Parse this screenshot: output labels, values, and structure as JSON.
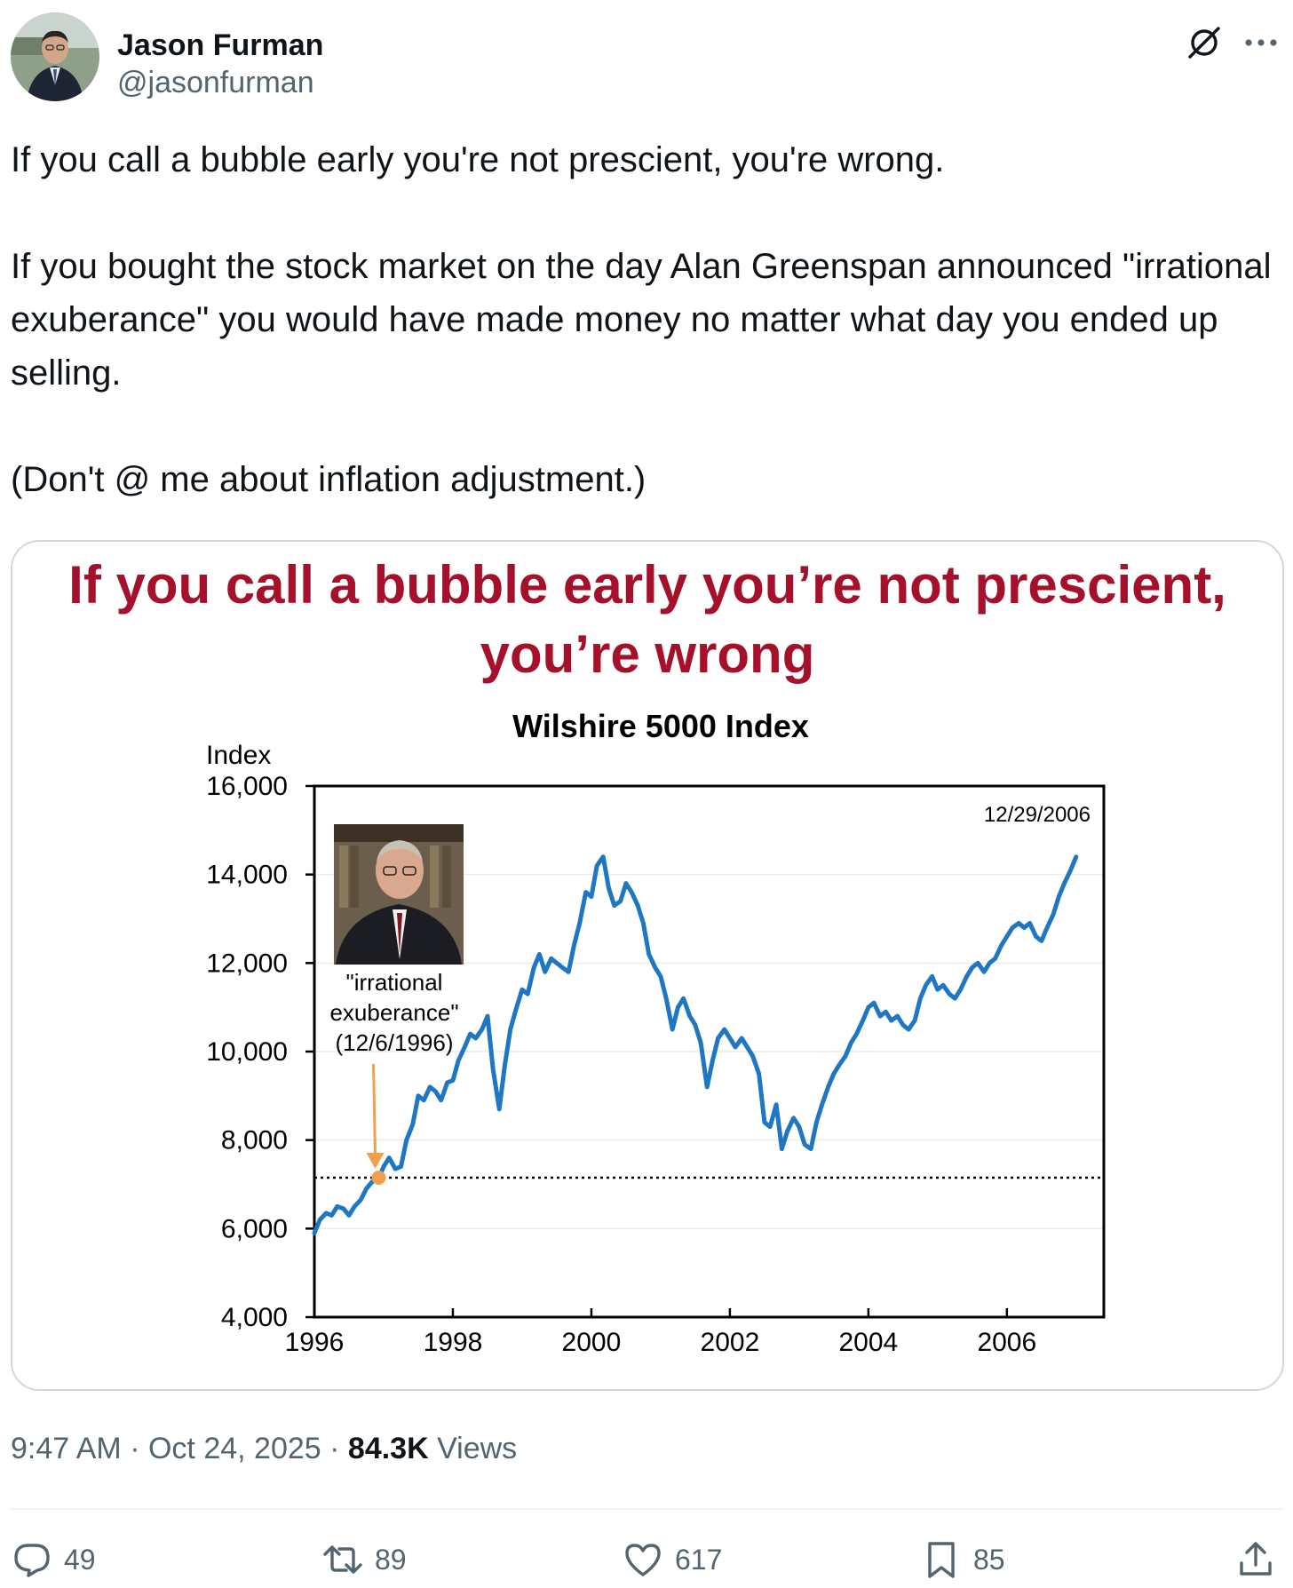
{
  "author": {
    "name": "Jason Furman",
    "handle": "@jasonfurman"
  },
  "tweet": {
    "paragraphs": [
      "If you call a bubble early you're not prescient, you're wrong.",
      "If you bought the stock market on the day Alan Greenspan announced \"irrational exuberance\" you would have made money no matter what day you ended up selling.",
      "(Don't @ me about inflation adjustment.)"
    ]
  },
  "media": {
    "slide_title": "If you call a bubble early you’re not prescient, you’re wrong"
  },
  "chart_data": {
    "type": "line",
    "title": "Wilshire 5000 Index",
    "ylabel": "Index",
    "xlabel": "",
    "ylim": [
      4000,
      16000
    ],
    "xlim": [
      1996,
      2007.4
    ],
    "y_ticks": [
      "4,000",
      "6,000",
      "8,000",
      "10,000",
      "12,000",
      "14,000",
      "16,000"
    ],
    "x_ticks": [
      "1996",
      "1998",
      "2000",
      "2002",
      "2004",
      "2006"
    ],
    "annotation_label": [
      "\"irrational",
      "exuberance\"",
      "(12/6/1996)"
    ],
    "annotation_point": {
      "x": 1996.93,
      "y": 7150
    },
    "reference_line_y": 7150,
    "end_date_label": "12/29/2006",
    "line_color": "#1f77c4",
    "series": [
      {
        "x": [
          1996.0,
          1996.08,
          1996.17,
          1996.25,
          1996.33,
          1996.42,
          1996.5,
          1996.58,
          1996.67,
          1996.75,
          1996.83,
          1996.93,
          1997.0,
          1997.08,
          1997.17,
          1997.25,
          1997.33,
          1997.42,
          1997.5,
          1997.58,
          1997.67,
          1997.75,
          1997.83,
          1997.92,
          1998.0,
          1998.08,
          1998.17,
          1998.25,
          1998.33,
          1998.42,
          1998.5,
          1998.58,
          1998.67,
          1998.75,
          1998.83,
          1998.92,
          1999.0,
          1999.08,
          1999.17,
          1999.25,
          1999.33,
          1999.42,
          1999.5,
          1999.58,
          1999.67,
          1999.75,
          1999.83,
          1999.92,
          2000.0,
          2000.08,
          2000.17,
          2000.25,
          2000.33,
          2000.42,
          2000.5,
          2000.58,
          2000.67,
          2000.75,
          2000.83,
          2000.92,
          2001.0,
          2001.08,
          2001.17,
          2001.25,
          2001.33,
          2001.42,
          2001.5,
          2001.58,
          2001.67,
          2001.75,
          2001.83,
          2001.92,
          2002.0,
          2002.08,
          2002.17,
          2002.25,
          2002.33,
          2002.42,
          2002.5,
          2002.58,
          2002.67,
          2002.75,
          2002.83,
          2002.92,
          2003.0,
          2003.08,
          2003.17,
          2003.25,
          2003.33,
          2003.42,
          2003.5,
          2003.58,
          2003.67,
          2003.75,
          2003.83,
          2003.92,
          2004.0,
          2004.08,
          2004.17,
          2004.25,
          2004.33,
          2004.42,
          2004.5,
          2004.58,
          2004.67,
          2004.75,
          2004.83,
          2004.92,
          2005.0,
          2005.08,
          2005.17,
          2005.25,
          2005.33,
          2005.42,
          2005.5,
          2005.58,
          2005.67,
          2005.75,
          2005.83,
          2005.92,
          2006.0,
          2006.08,
          2006.17,
          2006.25,
          2006.33,
          2006.42,
          2006.5,
          2006.58,
          2006.67,
          2006.75,
          2006.83,
          2006.92,
          2007.0
        ],
        "values": [
          5900,
          6200,
          6350,
          6300,
          6500,
          6450,
          6300,
          6500,
          6650,
          6900,
          7050,
          7150,
          7400,
          7600,
          7350,
          7400,
          8000,
          8350,
          9000,
          8900,
          9200,
          9100,
          8900,
          9300,
          9350,
          9800,
          10100,
          10400,
          10300,
          10500,
          10800,
          9600,
          8700,
          9700,
          10500,
          11000,
          11400,
          11300,
          11900,
          12200,
          11800,
          12100,
          12000,
          11900,
          11800,
          12400,
          12900,
          13600,
          13500,
          14200,
          14400,
          13700,
          13300,
          13400,
          13800,
          13600,
          13300,
          12900,
          12200,
          11900,
          11700,
          11200,
          10500,
          11000,
          11200,
          10800,
          10600,
          10200,
          9200,
          9800,
          10300,
          10500,
          10300,
          10100,
          10300,
          10100,
          9900,
          9500,
          8400,
          8300,
          8800,
          7800,
          8200,
          8500,
          8300,
          7900,
          7800,
          8400,
          8800,
          9200,
          9500,
          9700,
          9900,
          10200,
          10400,
          10700,
          11000,
          11100,
          10800,
          10900,
          10700,
          10800,
          10600,
          10500,
          10700,
          11200,
          11500,
          11700,
          11400,
          11500,
          11300,
          11200,
          11400,
          11700,
          11900,
          12000,
          11800,
          12000,
          12100,
          12400,
          12600,
          12800,
          12900,
          12800,
          12900,
          12600,
          12500,
          12800,
          13100,
          13500,
          13800,
          14100,
          14400
        ]
      }
    ]
  },
  "timestamp": {
    "time": "9:47 AM",
    "separator": "·",
    "date": "Oct 24, 2025",
    "views_count": "84.3K",
    "views_label": "Views"
  },
  "actions": {
    "replies": "49",
    "reposts": "89",
    "likes": "617",
    "bookmarks": "85"
  },
  "colors": {
    "title_red": "#a5102a",
    "series_blue": "#1f77c4",
    "annotation_orange": "#f0a04b",
    "muted_text": "#536471",
    "border": "#cfd9de"
  }
}
